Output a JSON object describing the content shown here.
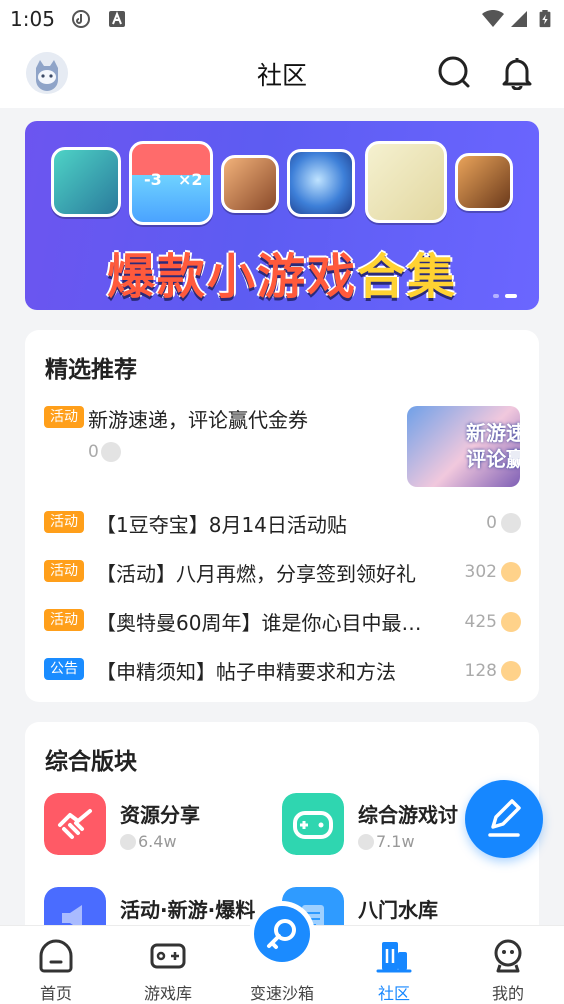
{
  "status": {
    "time": "1:05"
  },
  "header": {
    "title": "社区"
  },
  "banner": {
    "text_main": "爆款小游戏",
    "text_gold": "合集",
    "tile_label_a": "-3",
    "tile_label_b": "×2"
  },
  "featured": {
    "title": "精选推荐",
    "top_post": {
      "tag": "活动",
      "title": "新游速递，评论赢代金券",
      "count": "0",
      "thumb_text_1": "新游速",
      "thumb_text_2": "评论赢"
    },
    "posts": [
      {
        "tag": "活动",
        "title": "【1豆夺宝】8月14日活动贴",
        "count": "0"
      },
      {
        "tag": "活动",
        "title": "【活动】八月再燃，分享签到领好礼",
        "count": "302"
      },
      {
        "tag": "活动",
        "title": "【奥特曼60周年】谁是你心目中最…",
        "count": "425"
      },
      {
        "tag": "公告",
        "title": "【申精须知】帖子申精要求和方法",
        "count": "128"
      }
    ]
  },
  "boards": {
    "title": "综合版块",
    "items": [
      {
        "name": "资源分享",
        "count": "6.4w"
      },
      {
        "name": "综合游戏讨",
        "count": "7.1w"
      },
      {
        "name": "活动·新游·爆料",
        "count": ""
      },
      {
        "name": "八门水库",
        "count": ""
      }
    ]
  },
  "nav": {
    "items": [
      {
        "label": "首页"
      },
      {
        "label": "游戏库"
      },
      {
        "label": "变速沙箱"
      },
      {
        "label": "社区"
      },
      {
        "label": "我的"
      }
    ]
  },
  "colors": {
    "accent": "#1687ff",
    "activity_tag": "#ff9f1a",
    "notice_tag": "#1a8cff"
  }
}
